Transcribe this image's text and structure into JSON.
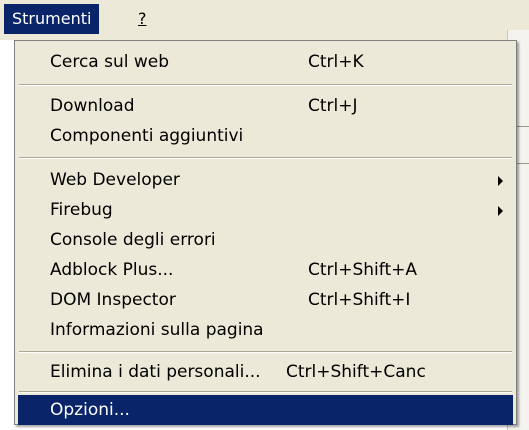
{
  "menubar": {
    "items": [
      {
        "label": "Strumenti",
        "active": true
      },
      {
        "label": "?",
        "active": false
      }
    ]
  },
  "menu": {
    "items": [
      {
        "id": "cerca",
        "label": "Cerca sul web",
        "shortcut": "Ctrl+K"
      },
      {
        "id": "download",
        "label": "Download",
        "shortcut": "Ctrl+J"
      },
      {
        "id": "componenti",
        "label": "Componenti aggiuntivi",
        "shortcut": ""
      },
      {
        "id": "webdev",
        "label": "Web Developer",
        "shortcut": "",
        "submenu": true
      },
      {
        "id": "firebug",
        "label": "Firebug",
        "shortcut": "",
        "submenu": true
      },
      {
        "id": "console",
        "label": "Console degli errori",
        "shortcut": ""
      },
      {
        "id": "adblock",
        "label": "Adblock Plus...",
        "shortcut": "Ctrl+Shift+A"
      },
      {
        "id": "dom",
        "label": "DOM Inspector",
        "shortcut": "Ctrl+Shift+I"
      },
      {
        "id": "info",
        "label": "Informazioni sulla pagina",
        "shortcut": ""
      },
      {
        "id": "elimina",
        "label": "Elimina i dati personali...",
        "shortcut": "Ctrl+Shift+Canc"
      },
      {
        "id": "opzioni",
        "label": "Opzioni...",
        "shortcut": "",
        "highlighted": true
      }
    ]
  },
  "colors": {
    "highlight": "#0a246a",
    "menu_bg": "#ece9d8"
  }
}
